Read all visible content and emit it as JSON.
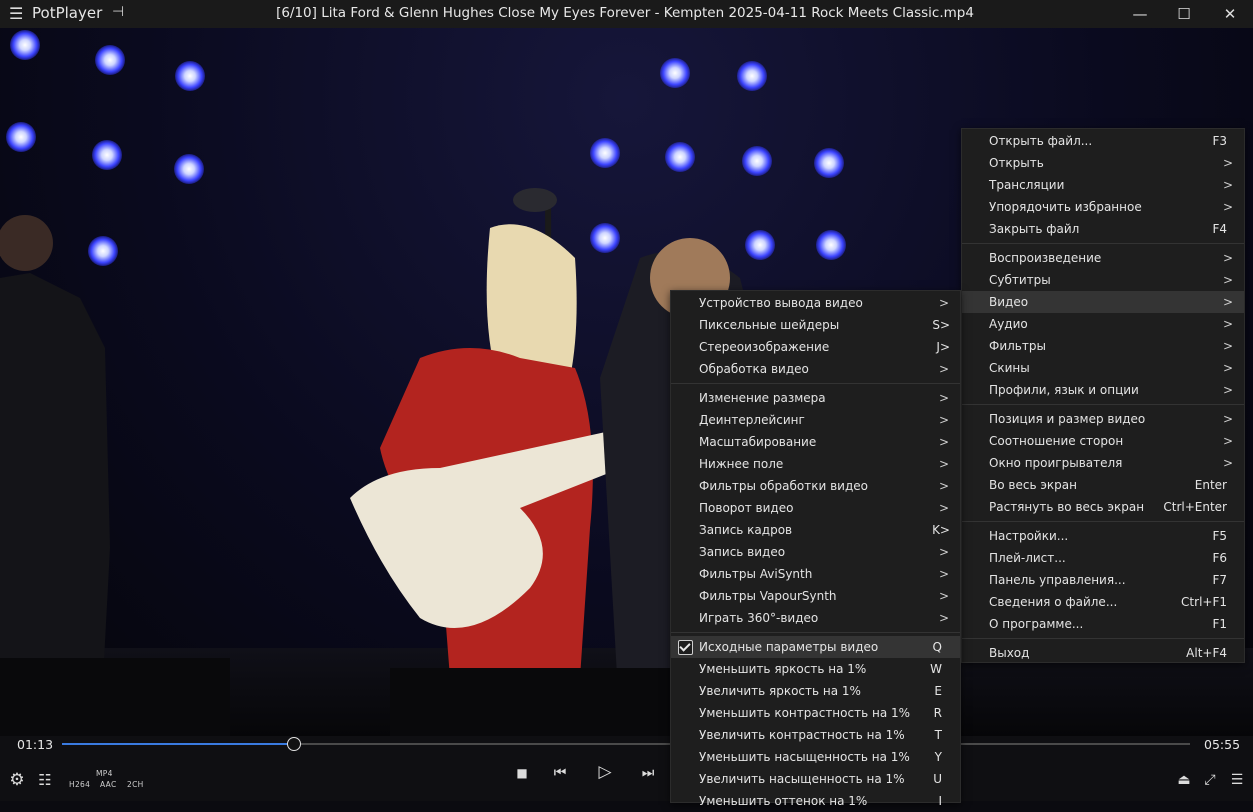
{
  "window": {
    "app_name": "PotPlayer",
    "title": "[6/10] Lita Ford & Glenn Hughes Close My Eyes Forever - Kempten 2025-04-11 Rock Meets Classic.mp4",
    "menu_icon": "☰",
    "pin_icon": "⊣",
    "minimize": "—",
    "maximize": "☐",
    "close": "✕"
  },
  "player": {
    "elapsed": "01:13",
    "total": "05:55",
    "progress": 0.2056,
    "format_container": "MP4",
    "format_video": "H264",
    "format_audio": "AAC",
    "format_channels": "2CH",
    "accent": "#3a7be0"
  },
  "main_menu": {
    "items": [
      {
        "label": "Открыть файл...",
        "shortcut": "F3",
        "arrow": ""
      },
      {
        "label": "Открыть",
        "shortcut": "",
        "arrow": ">"
      },
      {
        "label": "Трансляции",
        "shortcut": "",
        "arrow": ">"
      },
      {
        "label": "Упорядочить избранное",
        "shortcut": "",
        "arrow": ">"
      },
      {
        "label": "Закрыть файл",
        "shortcut": "F4",
        "arrow": ""
      },
      {
        "label": "Воспроизведение",
        "shortcut": "",
        "arrow": ">"
      },
      {
        "label": "Субтитры",
        "shortcut": "",
        "arrow": ">"
      },
      {
        "label": "Видео",
        "shortcut": "",
        "arrow": ">"
      },
      {
        "label": "Аудио",
        "shortcut": "",
        "arrow": ">"
      },
      {
        "label": "Фильтры",
        "shortcut": "",
        "arrow": ">"
      },
      {
        "label": "Скины",
        "shortcut": "",
        "arrow": ">"
      },
      {
        "label": "Профили, язык и опции",
        "shortcut": "",
        "arrow": ">"
      },
      {
        "label": "Позиция и размер видео",
        "shortcut": "",
        "arrow": ">"
      },
      {
        "label": "Соотношение сторон",
        "shortcut": "",
        "arrow": ">"
      },
      {
        "label": "Окно проигрывателя",
        "shortcut": "",
        "arrow": ">"
      },
      {
        "label": "Во весь экран",
        "shortcut": "Enter",
        "arrow": ""
      },
      {
        "label": "Растянуть во весь экран",
        "shortcut": "Ctrl+Enter",
        "arrow": ""
      },
      {
        "label": "Настройки...",
        "shortcut": "F5",
        "arrow": ""
      },
      {
        "label": "Плей-лист...",
        "shortcut": "F6",
        "arrow": ""
      },
      {
        "label": "Панель управления...",
        "shortcut": "F7",
        "arrow": ""
      },
      {
        "label": "Сведения о файле...",
        "shortcut": "Ctrl+F1",
        "arrow": ""
      },
      {
        "label": "О программе...",
        "shortcut": "F1",
        "arrow": ""
      },
      {
        "label": "Выход",
        "shortcut": "Alt+F4",
        "arrow": ""
      }
    ]
  },
  "video_menu": {
    "items": [
      {
        "label": "Устройство вывода видео",
        "shortcut": "",
        "arrow": ">"
      },
      {
        "label": "Пиксельные шейдеры",
        "shortcut": "S>",
        "arrow": ""
      },
      {
        "label": "Стереоизображение",
        "shortcut": "J>",
        "arrow": ""
      },
      {
        "label": "Обработка видео",
        "shortcut": "",
        "arrow": ">"
      },
      {
        "label": "Изменение размера",
        "shortcut": "",
        "arrow": ">"
      },
      {
        "label": "Деинтерлейсинг",
        "shortcut": "",
        "arrow": ">"
      },
      {
        "label": "Масштабирование",
        "shortcut": "",
        "arrow": ">"
      },
      {
        "label": "Нижнее поле",
        "shortcut": "",
        "arrow": ">"
      },
      {
        "label": "Фильтры обработки видео",
        "shortcut": "",
        "arrow": ">"
      },
      {
        "label": "Поворот видео",
        "shortcut": "",
        "arrow": ">"
      },
      {
        "label": "Запись кадров",
        "shortcut": "K>",
        "arrow": ""
      },
      {
        "label": "Запись видео",
        "shortcut": "",
        "arrow": ">"
      },
      {
        "label": "Фильтры AviSynth",
        "shortcut": "",
        "arrow": ">"
      },
      {
        "label": "Фильтры VapourSynth",
        "shortcut": "",
        "arrow": ">"
      },
      {
        "label": "Играть 360°-видео",
        "shortcut": "",
        "arrow": ">"
      },
      {
        "label": "Исходные параметры видео",
        "shortcut": "Q",
        "arrow": ""
      },
      {
        "label": "Уменьшить яркость на 1%",
        "shortcut": "W",
        "arrow": ""
      },
      {
        "label": "Увеличить яркость на 1%",
        "shortcut": "E",
        "arrow": ""
      },
      {
        "label": "Уменьшить контрастность на 1%",
        "shortcut": "R",
        "arrow": ""
      },
      {
        "label": "Увеличить контрастность на 1%",
        "shortcut": "T",
        "arrow": ""
      },
      {
        "label": "Уменьшить насыщенность на 1%",
        "shortcut": "Y",
        "arrow": ""
      },
      {
        "label": "Увеличить насыщенность на 1%",
        "shortcut": "U",
        "arrow": ""
      },
      {
        "label": "Уменьшить оттенок на 1%",
        "shortcut": "I",
        "arrow": ""
      }
    ]
  }
}
